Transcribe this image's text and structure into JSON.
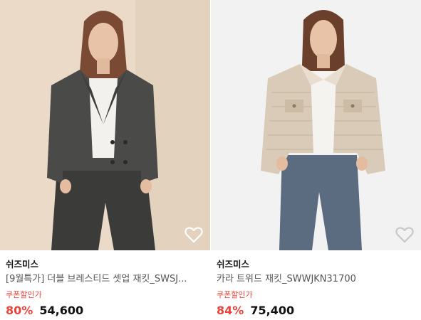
{
  "products": [
    {
      "brand": "쉬즈미스",
      "title": "[9월특가] 더블 브레스티드 셋업 재킷_SWSJ...",
      "coupon_label": "쿠폰할인가",
      "discount": "80%",
      "price": "54,600",
      "photo": "model-charcoal-double-breasted-jacket",
      "photo_bg": "#e9d8c4",
      "garment_color": "#4a4a48"
    },
    {
      "brand": "쉬즈미스",
      "title": "카라 트위드 재킷_SWWJKN31700",
      "coupon_label": "쿠폰할인가",
      "discount": "84%",
      "price": "75,400",
      "photo": "model-beige-tweed-jacket",
      "photo_bg": "#f2f2f2",
      "garment_color": "#d9cbb8"
    }
  ],
  "colors": {
    "accent": "#e9443a",
    "heart": "#ffffff"
  },
  "icons": [
    "heart-icon"
  ]
}
